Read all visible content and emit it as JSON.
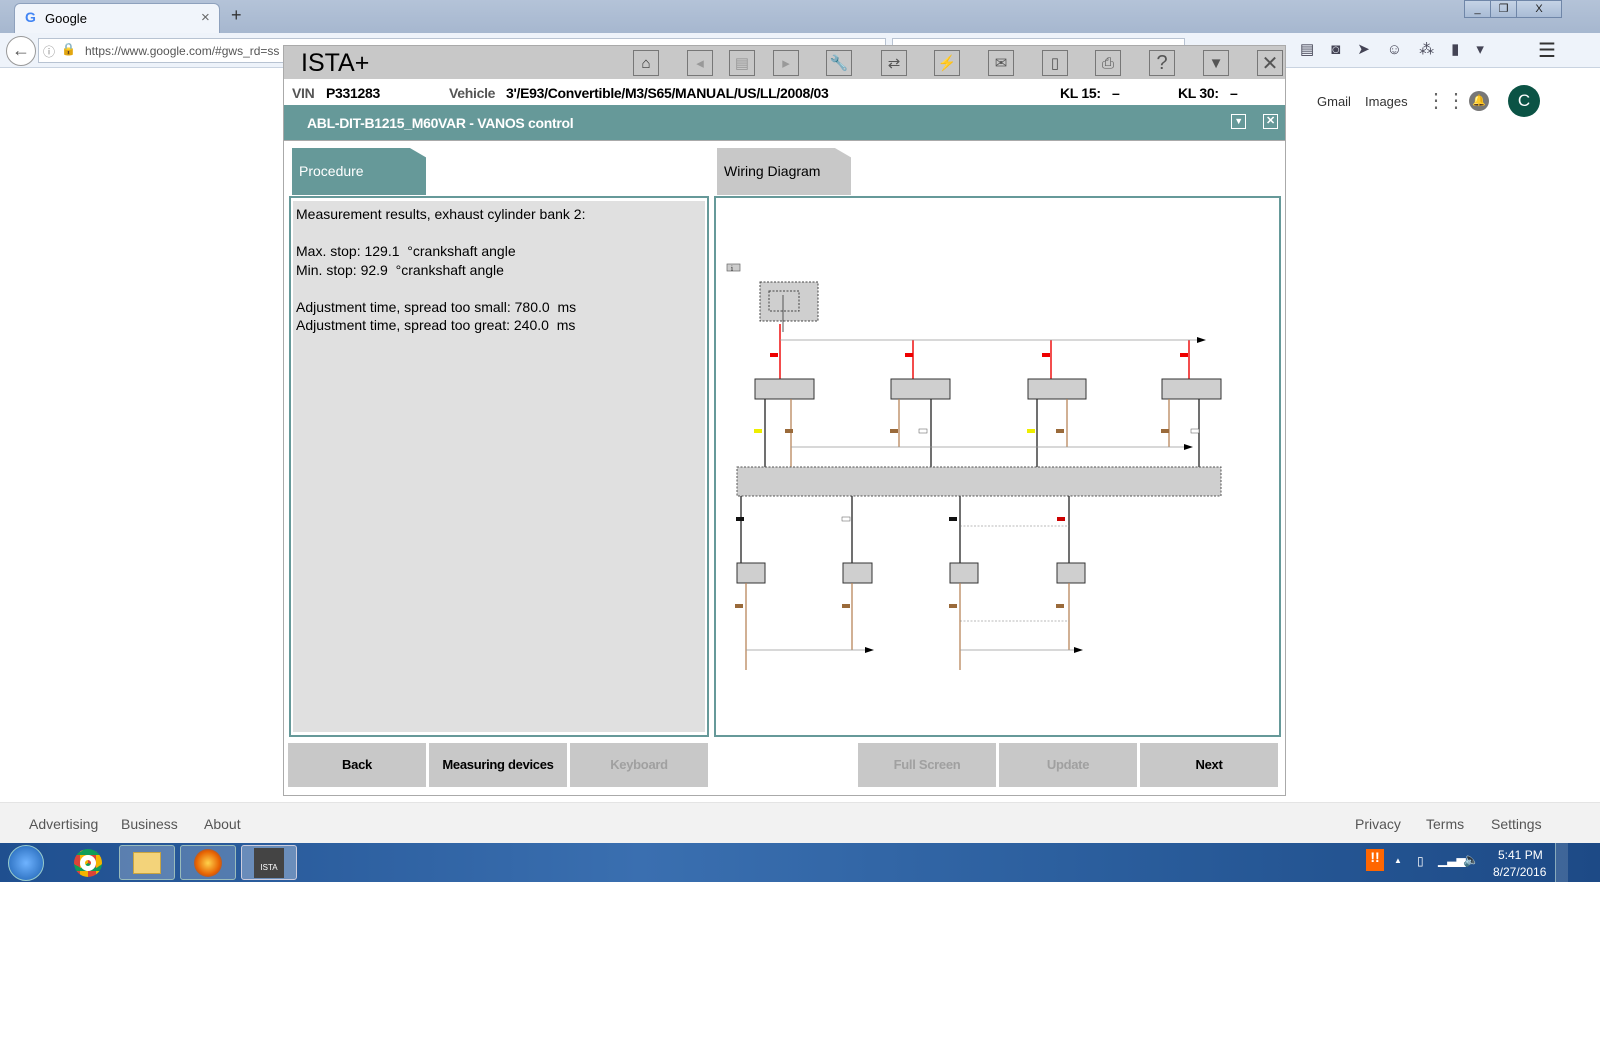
{
  "browser": {
    "tab_title": "Google",
    "url": "https://www.google.com/#gws_rd=ss",
    "tab_close": "×",
    "new_tab": "+",
    "win_min": "_",
    "win_max": "❐",
    "win_close": "X"
  },
  "google": {
    "header_links": [
      "Gmail",
      "Images"
    ],
    "avatar_letter": "C",
    "footer_left": [
      "Advertising",
      "Business",
      "About"
    ],
    "footer_right": [
      "Privacy",
      "Terms",
      "Settings"
    ]
  },
  "ista": {
    "app_title": "ISTA+",
    "toolbar_icons": [
      "home-icon",
      "back-arrow-icon",
      "document-icon",
      "forward-arrow-icon",
      "wrench-icon",
      "swap-icon",
      "plug-icon",
      "mail-icon",
      "battery-icon",
      "printer-icon",
      "help-icon",
      "minimize-panel-icon",
      "close-icon"
    ],
    "vin_label": "VIN",
    "vin": "P331283",
    "vehicle_label": "Vehicle",
    "vehicle": "3'/E93/Convertible/M3/S65/MANUAL/US/LL/2008/03",
    "kl15_label": "KL 15:",
    "kl15": "–",
    "kl30_label": "KL 30:",
    "kl30": "–",
    "section_title": "ABL-DIT-B1215_M60VAR  -  VANOS control",
    "tabs": {
      "procedure": "Procedure",
      "wiring": "Wiring Diagram"
    },
    "procedure_text": "Measurement results, exhaust cylinder bank 2:\n\nMax. stop: 129.1  °crankshaft angle\nMin. stop: 92.9  °crankshaft angle\n\nAdjustment time, spread too small: 780.0  ms\nAdjustment time, spread too great: 240.0  ms",
    "buttons": {
      "back": "Back",
      "measuring": "Measuring devices",
      "keyboard": "Keyboard",
      "fullscreen": "Full Screen",
      "update": "Update",
      "next": "Next"
    },
    "accent": "#669999"
  },
  "taskbar": {
    "time": "5:41 PM",
    "date": "8/27/2016",
    "ista_label": "ISTA"
  }
}
